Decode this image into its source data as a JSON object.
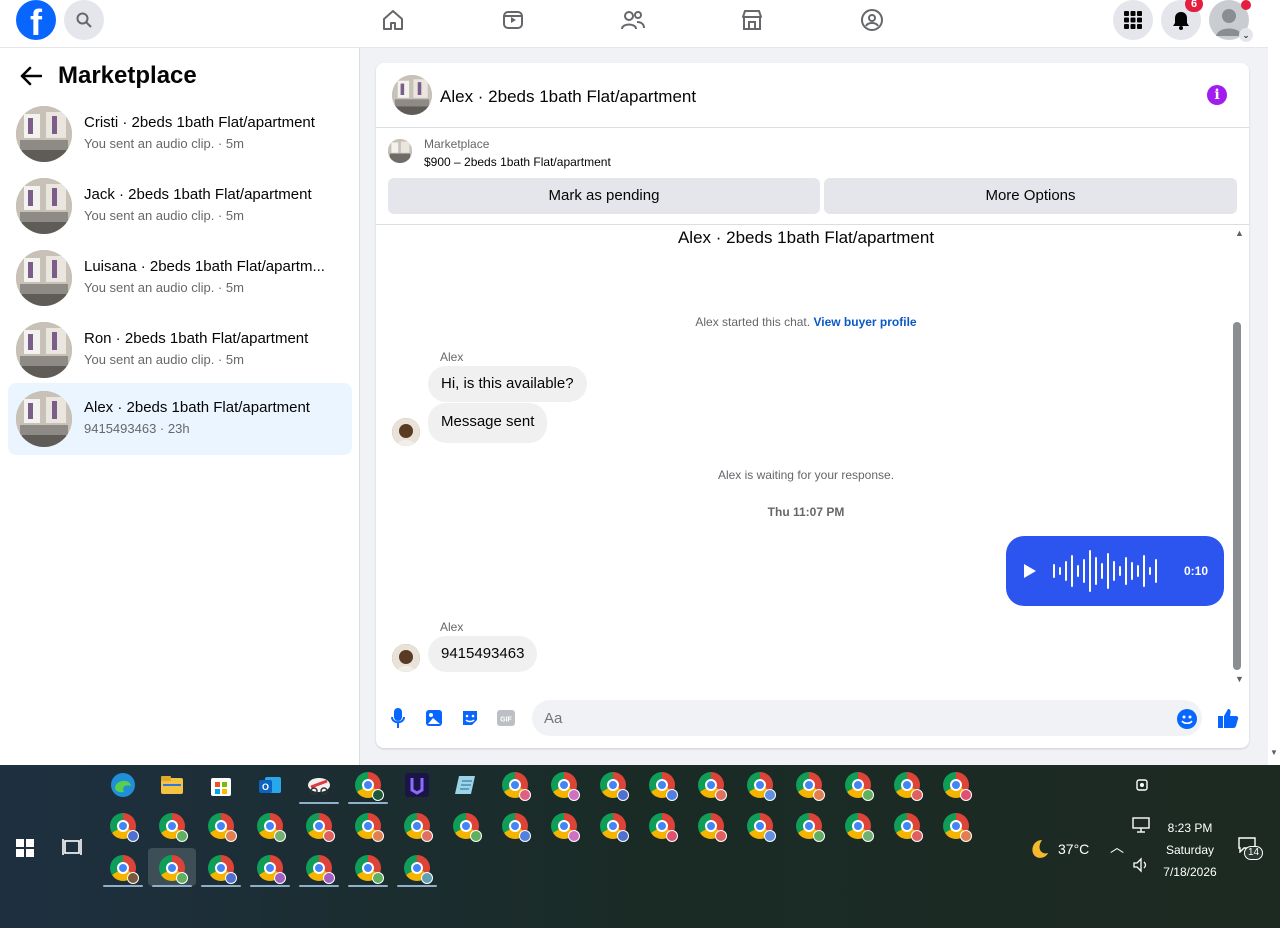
{
  "app": {
    "logo_letter": "f",
    "nav_icons": [
      "home-icon",
      "video-icon",
      "friends-icon",
      "marketplace-icon",
      "groups-icon"
    ],
    "notifications_count": "6"
  },
  "sidebar": {
    "title": "Marketplace",
    "conversations": [
      {
        "name": "Cristi · 2beds 1bath Flat/apartment",
        "sub": "You sent an audio clip. · 5m"
      },
      {
        "name": "Jack · 2beds 1bath Flat/apartment",
        "sub": "You sent an audio clip. · 5m"
      },
      {
        "name": "Luisana · 2beds 1bath Flat/apartm...",
        "sub": "You sent an audio clip. · 5m"
      },
      {
        "name": "Ron · 2beds 1bath Flat/apartment",
        "sub": "You sent an audio clip. · 5m"
      },
      {
        "name": "Alex · 2beds 1bath Flat/apartment",
        "sub": "9415493463 · 23h"
      }
    ]
  },
  "chat": {
    "header_title": "Alex · 2beds 1bath Flat/apartment",
    "info_glyph": "i",
    "marketplace_label": "Marketplace",
    "listing": "$900 – 2beds 1bath Flat/apartment",
    "mark_pending": "Mark as pending",
    "more_options": "More Options",
    "convo_title": "Alex · 2beds 1bath Flat/apartment",
    "started_text": "Alex started this chat.",
    "view_profile": "View buyer profile",
    "sender1": "Alex",
    "msg1": "Hi, is this available?",
    "msg2": "Message sent",
    "waiting": "Alex is waiting for your response.",
    "timestamp": "Thu 11:07 PM",
    "audio_duration": "0:10",
    "sender2": "Alex",
    "msg3": "9415493463",
    "input_placeholder": "Aa"
  },
  "taskbar": {
    "temperature": "37°C",
    "time": "8:23 PM",
    "day": "Saturday",
    "date": "7/18/2026",
    "notifications": "14"
  },
  "colors": {
    "brand": "#0866ff",
    "audio_bubble": "#2c54ee",
    "info": "#a21cf0",
    "active_convo": "#ebf5ff"
  }
}
